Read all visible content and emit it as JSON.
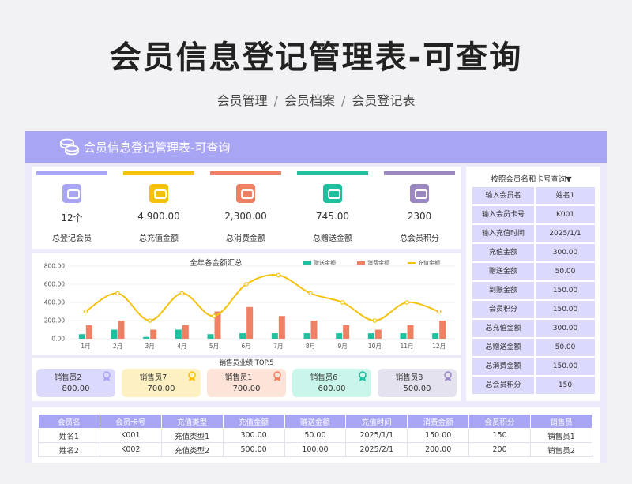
{
  "title": "会员信息登记管理表-可查询",
  "breadcrumb": [
    "会员管理",
    "会员档案",
    "会员登记表"
  ],
  "banner_title": "会员信息登记管理表-可查询",
  "kpis": [
    {
      "value": "12个",
      "label": "总登记会员",
      "color": "#a9a5f5"
    },
    {
      "value": "4,900.00",
      "label": "总充值金额",
      "color": "#f4c20d"
    },
    {
      "value": "2,300.00",
      "label": "总消费金额",
      "color": "#ee8064"
    },
    {
      "value": "745.00",
      "label": "总赠送金额",
      "color": "#1fbf9f"
    },
    {
      "value": "2300",
      "label": "总会员积分",
      "color": "#9b87c4"
    }
  ],
  "query": {
    "title": "按照会员名和卡号查询▼",
    "rows": [
      {
        "k": "输入会员名",
        "v": "姓名1"
      },
      {
        "k": "输入会员卡号",
        "v": "K001"
      },
      {
        "k": "输入充值时间",
        "v": "2025/1/1"
      },
      {
        "k": "充值金额",
        "v": "300.00"
      },
      {
        "k": "赠送金额",
        "v": "50.00"
      },
      {
        "k": "到账金额",
        "v": "150.00"
      },
      {
        "k": "会员积分",
        "v": "150.00"
      },
      {
        "k": "总充值金额",
        "v": "300.00"
      },
      {
        "k": "总赠送金额",
        "v": "50.00"
      },
      {
        "k": "总消费金额",
        "v": "150.00"
      },
      {
        "k": "总会员积分",
        "v": "150"
      }
    ]
  },
  "chart_data": {
    "type": "bar",
    "title": "全年各金额汇总",
    "categories": [
      "1月",
      "2月",
      "3月",
      "4月",
      "5月",
      "6月",
      "7月",
      "8月",
      "9月",
      "10月",
      "11月",
      "12月"
    ],
    "series": [
      {
        "name": "赠送金额",
        "type": "bar",
        "color": "#1fbf9f",
        "values": [
          50,
          100,
          20,
          100,
          50,
          60,
          60,
          60,
          60,
          60,
          60,
          60
        ]
      },
      {
        "name": "消费金额",
        "type": "bar",
        "color": "#ee8064",
        "values": [
          150,
          200,
          100,
          150,
          300,
          350,
          250,
          200,
          150,
          100,
          150,
          200
        ]
      },
      {
        "name": "充值金额",
        "type": "line",
        "color": "#f4c20d",
        "values": [
          300,
          500,
          200,
          500,
          250,
          600,
          700,
          500,
          400,
          200,
          400,
          300
        ]
      }
    ],
    "yticks": [
      "0.00",
      "200.00",
      "400.00",
      "600.00",
      "800.00"
    ],
    "ylim": [
      0,
      800
    ]
  },
  "top5": {
    "title": "销售员业绩 TOP.5",
    "items": [
      {
        "name": "销售员2",
        "value": "800.00",
        "bg": "#dcdafc",
        "medal": "#a9a5f5"
      },
      {
        "name": "销售员7",
        "value": "700.00",
        "bg": "#fdf0c2",
        "medal": "#f4c20d"
      },
      {
        "name": "销售员1",
        "value": "700.00",
        "bg": "#fde3d8",
        "medal": "#ee8064"
      },
      {
        "name": "销售员6",
        "value": "600.00",
        "bg": "#c9f5ea",
        "medal": "#1fbf9f"
      },
      {
        "name": "销售员8",
        "value": "500.00",
        "bg": "#e4e2ee",
        "medal": "#9b87c4"
      }
    ]
  },
  "table": {
    "headers": [
      "会员名",
      "会员卡号",
      "充值类型",
      "充值金额",
      "赠送金额",
      "充值时间",
      "消费金额",
      "会员积分",
      "销售员"
    ],
    "rows": [
      [
        "姓名1",
        "K001",
        "充值类型1",
        "300.00",
        "50.00",
        "2025/1/1",
        "150.00",
        "150",
        "销售员1"
      ],
      [
        "姓名2",
        "K002",
        "充值类型2",
        "500.00",
        "100.00",
        "2025/2/1",
        "200.00",
        "200",
        "销售员2"
      ]
    ]
  }
}
